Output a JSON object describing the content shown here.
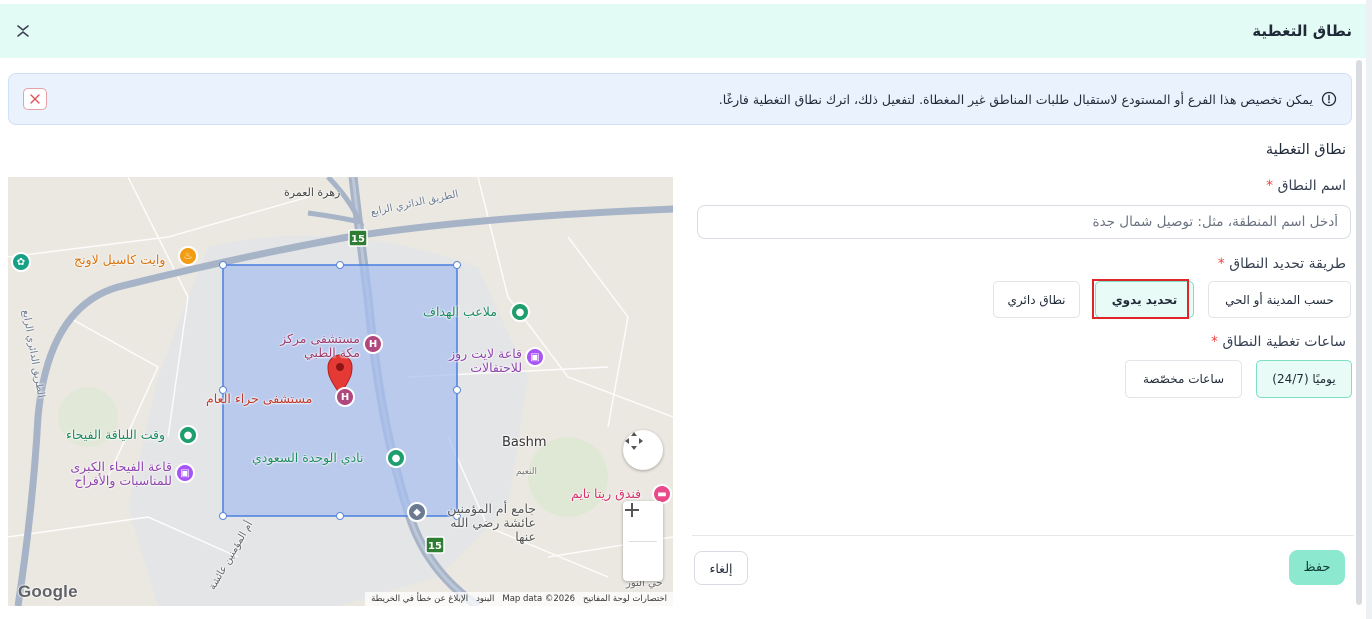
{
  "header": {
    "title": "نطاق التغطية"
  },
  "alert": {
    "text": "يمكن تخصيص هذا الفرع أو المستودع لاستقبال طلبات المناطق غير المغطاة. لتفعيل ذلك، اترك نطاق التغطية فارغًا."
  },
  "section_title": "نطاق التغطية",
  "zone_name": {
    "label": "اسم النطاق",
    "placeholder": "أدخل اسم المنطقة، مثل: توصيل شمال جدة"
  },
  "method": {
    "label": "طريقة تحديد النطاق",
    "options": [
      {
        "label": "حسب المدينة أو الحي",
        "selected": false
      },
      {
        "label": "تحديد يدوي",
        "selected": true
      },
      {
        "label": "نطاق دائري",
        "selected": false
      }
    ]
  },
  "hours": {
    "label": "ساعات تغطية النطاق",
    "options": [
      {
        "label": "يوميًا (24/7)",
        "selected": true
      },
      {
        "label": "ساعات مخصّصة",
        "selected": false
      }
    ]
  },
  "actions": {
    "cancel": "إلغاء",
    "save": "حفظ"
  },
  "map": {
    "labels": {
      "zahrat": "زهرة العمرة",
      "ring_road_top": "الطريق الدائري الرابع",
      "ring_road_left": "الطريق الدائري الرابع",
      "white_castle": "وايت كاسيل لاونج",
      "malaeb": "ملاعب الهداف",
      "makkah_hospital": "مستشفى مركز مكة الطبي",
      "hiraa_hospital": "مستشفى حراء العام",
      "light_rose": "قاعة لايت روز للاحتفالات",
      "fitness": "وقت اللياقة الفيحاء",
      "fayha_hall": "قاعة الفيحاء الكبرى للمناسبات والأفراح",
      "wehda": "نادي الوحدة السعودي",
      "bashm": "Bashm",
      "naeem": "النعيم",
      "mosque": "جامع أم المؤمنين عائشة رضي الله عنها",
      "rita_hotel": "فندق ريتا تايم",
      "umm_mominin": "أم المؤمنين عائشة",
      "nour": "حي النور",
      "route": "15"
    },
    "attribution": {
      "shortcuts": "اختصارات لوحة المفاتيح",
      "map_data": "Map data ©2026",
      "terms": "البنود",
      "report": "الإبلاغ عن خطأ في الخريطة"
    },
    "google": "Google",
    "colors": {
      "polygon_fill": "#a8bff0",
      "polygon_stroke": "#4a7fe0",
      "marker": "#e53935",
      "road": "#a7b4c8"
    }
  }
}
